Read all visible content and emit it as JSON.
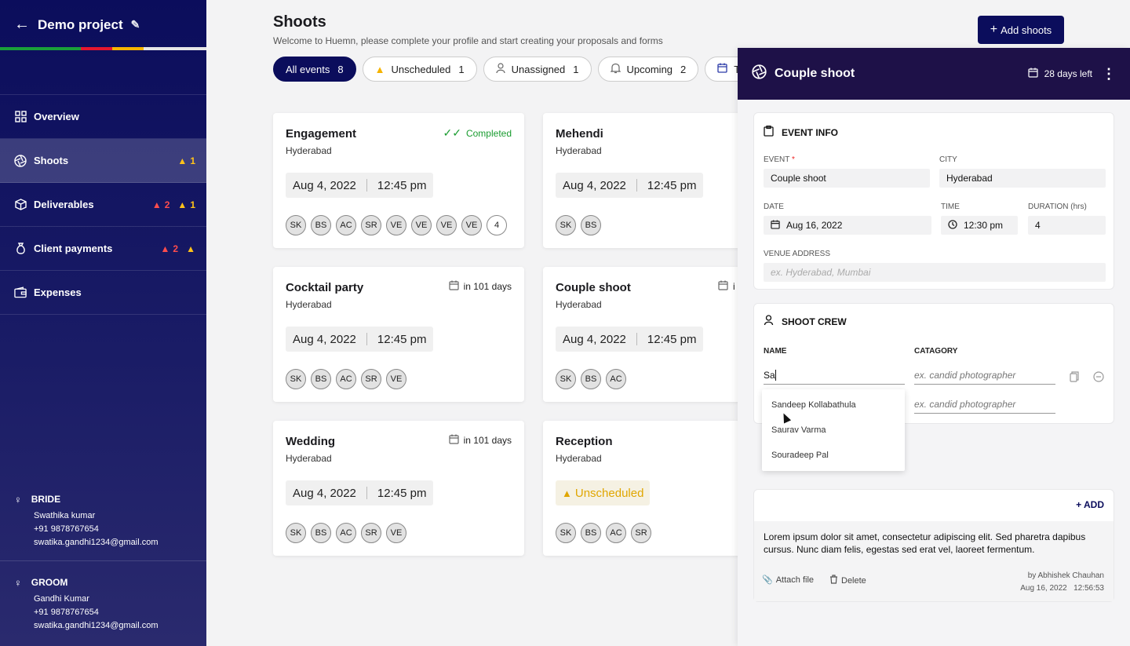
{
  "sidebar": {
    "project": "Demo project",
    "stripe_colors": [
      "#1aa03a",
      "#e5172f",
      "#f7b500",
      "#e6e6e6"
    ],
    "items": [
      {
        "label": "Overview",
        "icon": "grid-icon"
      },
      {
        "label": "Shoots",
        "icon": "aperture-icon",
        "warn": "1"
      },
      {
        "label": "Deliverables",
        "icon": "box-icon",
        "alert": "2",
        "warn": "1"
      },
      {
        "label": "Client payments",
        "icon": "money-bag-icon",
        "alert": "2",
        "warn": ""
      },
      {
        "label": "Expenses",
        "icon": "wallet-icon"
      }
    ],
    "bride": {
      "role": "BRIDE",
      "name": "Swathika kumar",
      "phone": "+91 9878767654",
      "email": "swatika.gandhi1234@gmail.com"
    },
    "groom": {
      "role": "GROOM",
      "name": "Gandhi Kumar",
      "phone": "+91 9878767654",
      "email": "swatika.gandhi1234@gmail.com"
    }
  },
  "main": {
    "title": "Shoots",
    "subtitle": "Welcome to Huemn, please complete your profile and start creating your proposals and forms",
    "add_button": "Add shoots",
    "filters": [
      {
        "label": "All events",
        "count": "8"
      },
      {
        "label": "Unscheduled",
        "count": "1"
      },
      {
        "label": "Unassigned",
        "count": "1"
      },
      {
        "label": "Upcoming",
        "count": "2"
      },
      {
        "label": "To",
        "count": ""
      }
    ],
    "cards": [
      {
        "name": "Engagement",
        "city": "Hyderabad",
        "status": "Completed",
        "date": "Aug 4, 2022",
        "time": "12:45 pm",
        "crew": [
          "SK",
          "BS",
          "AC",
          "SR",
          "VE",
          "VE",
          "VE",
          "VE"
        ],
        "more": "4"
      },
      {
        "name": "Mehendi",
        "city": "Hyderabad",
        "status": "",
        "date": "Aug 4, 2022",
        "time": "12:45 pm",
        "crew": [
          "SK",
          "BS"
        ],
        "more": ""
      },
      {
        "name": "Cocktail party",
        "city": "Hyderabad",
        "status": "in 101 days",
        "date": "Aug 4, 2022",
        "time": "12:45 pm",
        "crew": [
          "SK",
          "BS",
          "AC",
          "SR",
          "VE"
        ],
        "more": ""
      },
      {
        "name": "Couple shoot",
        "city": "Hyderabad",
        "status": "i",
        "date": "Aug 4, 2022",
        "time": "12:45 pm",
        "crew": [
          "SK",
          "BS",
          "AC"
        ],
        "more": ""
      },
      {
        "name": "Wedding",
        "city": "Hyderabad",
        "status": "in 101 days",
        "date": "Aug 4, 2022",
        "time": "12:45 pm",
        "crew": [
          "SK",
          "BS",
          "AC",
          "SR",
          "VE"
        ],
        "more": ""
      },
      {
        "name": "Reception",
        "city": "Hyderabad",
        "status": "",
        "unscheduled": "Unscheduled",
        "crew": [
          "SK",
          "BS",
          "AC",
          "SR"
        ],
        "more": ""
      }
    ]
  },
  "panel": {
    "title": "Couple shoot",
    "days_left": "28 days left",
    "event_info": {
      "heading": "EVENT INFO",
      "event_label": "EVENT",
      "event_value": "Couple shoot",
      "city_label": "CITY",
      "city_value": "Hyderabad",
      "date_label": "DATE",
      "date_value": "Aug 16, 2022",
      "time_label": "TIME",
      "time_value": "12:30 pm",
      "duration_label": "DURATION (hrs)",
      "duration_value": "4",
      "venue_label": "VENUE ADDRESS",
      "venue_placeholder": "ex. Hyderabad, Mumbai"
    },
    "crew": {
      "heading": "SHOOT CREW",
      "name_label": "NAME",
      "category_label": "CATAGORY",
      "name_value": "Sa",
      "category_placeholder": "ex. candid photographer",
      "suggestions": [
        "Sandeep Kollabathula",
        "Saurav Varma",
        "Souradeep Pal"
      ]
    },
    "notes": {
      "add": "+ ADD",
      "text": "Lorem ipsum dolor sit amet, consectetur adipiscing elit. Sed pharetra dapibus cursus. Nunc diam felis, egestas sed erat vel, laoreet fermentum.",
      "attach": "Attach file",
      "delete": "Delete",
      "by": "by Abhishek Chauhan",
      "date": "Aug 16, 2022",
      "time": "12:56:53"
    }
  }
}
